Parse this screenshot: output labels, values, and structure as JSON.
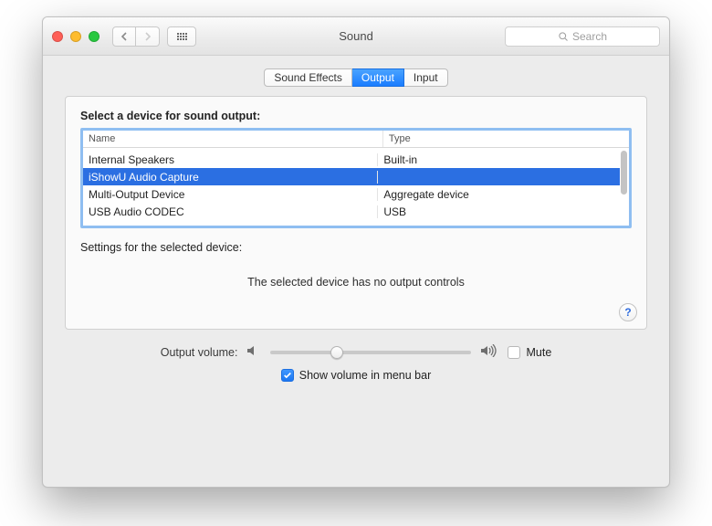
{
  "window": {
    "title": "Sound",
    "search_placeholder": "Search"
  },
  "tabs": {
    "sound_effects": "Sound Effects",
    "output": "Output",
    "input": "Input",
    "active": "output"
  },
  "panel": {
    "heading": "Select a device for sound output:",
    "columns": {
      "name": "Name",
      "type": "Type"
    },
    "devices": [
      {
        "name": "Internal Speakers",
        "type": "Built-in",
        "selected": false
      },
      {
        "name": "iShowU Audio Capture",
        "type": "",
        "selected": true
      },
      {
        "name": "Multi-Output Device",
        "type": "Aggregate device",
        "selected": false
      },
      {
        "name": "USB Audio CODEC",
        "type": "USB",
        "selected": false
      }
    ],
    "settings_label": "Settings for the selected device:",
    "no_controls": "The selected device has no output controls",
    "help": "?"
  },
  "volume": {
    "label": "Output volume:",
    "value_percent": 33,
    "mute_label": "Mute",
    "mute_checked": false
  },
  "menubar": {
    "label": "Show volume in menu bar",
    "checked": true
  }
}
